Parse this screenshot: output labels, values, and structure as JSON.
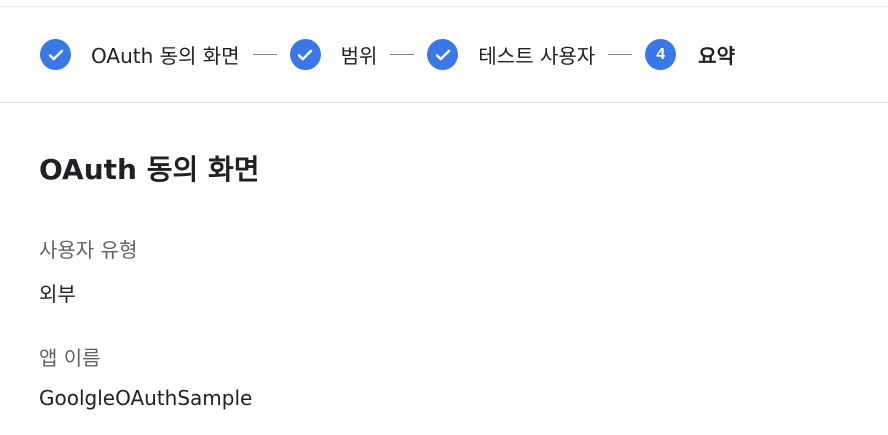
{
  "stepper": {
    "steps": [
      {
        "label": "OAuth 동의 화면",
        "state": "completed",
        "icon": "check-icon"
      },
      {
        "label": "범위",
        "state": "completed",
        "icon": "check-icon"
      },
      {
        "label": "테스트 사용자",
        "state": "completed",
        "icon": "check-icon"
      },
      {
        "label": "요약",
        "state": "active",
        "number": "4"
      }
    ],
    "accent_color": "#3b78e7"
  },
  "summary": {
    "title_bold": "OAuth",
    "title_rest": " 동의 화면",
    "user_type_label": "사용자 유형",
    "user_type_value": "외부",
    "app_name_label": "앱 이름",
    "app_name_value": "GoolgleOAuthSample"
  }
}
